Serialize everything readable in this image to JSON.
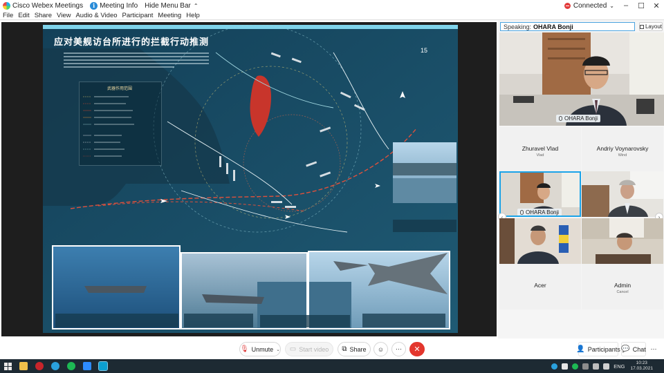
{
  "titlebar": {
    "app_name": "Cisco Webex Meetings",
    "meeting_info": "Meeting Info",
    "hide_menu": "Hide Menu Bar",
    "connection": "Connected",
    "minimize": "–",
    "maximize": "☐",
    "close": "✕"
  },
  "menu": [
    "File",
    "Edit",
    "Share",
    "View",
    "Audio & Video",
    "Participant",
    "Meeting",
    "Help"
  ],
  "slide": {
    "title": "应对美舰访台所进行的拦截行动推测",
    "page_number": "15",
    "legend_title": "武器作用范围",
    "accent_red": "#c8352b",
    "sea_color": "#1b4b63"
  },
  "panel": {
    "speaking_label": "Speaking:",
    "speaking_name": "OHARA Bonji",
    "layout_label": "Layout",
    "main_name": "OHARA Bonji",
    "tiles": [
      {
        "name": "Zhuravel Vlad",
        "sub": "Vlad"
      },
      {
        "name": "Andriy Voynarovsky",
        "sub": "Wind"
      },
      {
        "name": "OHARA Bonji",
        "sub": ""
      },
      {
        "name": "",
        "sub": ""
      },
      {
        "name": "",
        "sub": ""
      },
      {
        "name": "",
        "sub": ""
      },
      {
        "name": "Acer",
        "sub": ""
      },
      {
        "name": "Admin",
        "sub": "Cancel"
      }
    ]
  },
  "controls": {
    "unmute": "Unmute",
    "start_video": "Start video",
    "share": "Share",
    "participants": "Participants",
    "chat": "Chat",
    "end_color": "#e3362d"
  },
  "taskbar": {
    "lang": "ENG",
    "time": "10:23",
    "date": "17.03.2021"
  }
}
